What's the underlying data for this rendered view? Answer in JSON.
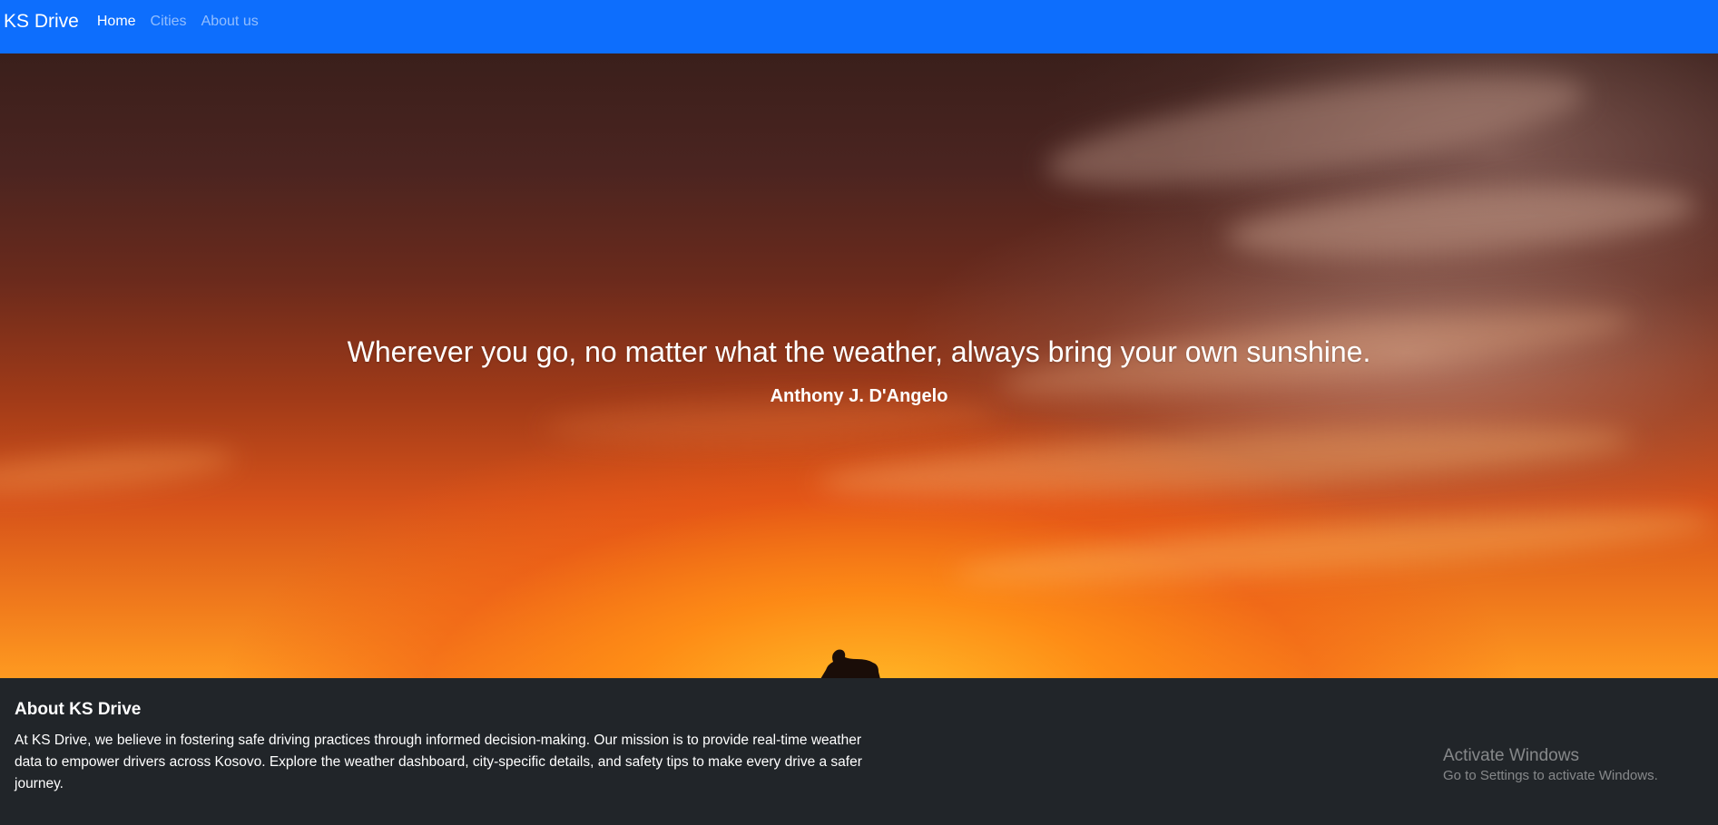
{
  "navbar": {
    "brand": "KS Drive",
    "links": [
      {
        "label": "Home",
        "active": true
      },
      {
        "label": "Cities",
        "active": false
      },
      {
        "label": "About us",
        "active": false
      }
    ],
    "color": "#0d6efd"
  },
  "hero": {
    "quote": "Wherever you go, no matter what the weather, always bring your own sunshine.",
    "author": "Anthony J. D'Angelo"
  },
  "about": {
    "title": "About KS Drive",
    "text": "At KS Drive, we believe in fostering safe driving practices through informed decision-making. Our mission is to provide real-time weather data to empower drivers across Kosovo. Explore the weather dashboard, city-specific details, and safety tips to make every drive a safer journey.",
    "background": "#212529"
  },
  "watermark": {
    "title": "Activate Windows",
    "subtitle": "Go to Settings to activate Windows."
  }
}
